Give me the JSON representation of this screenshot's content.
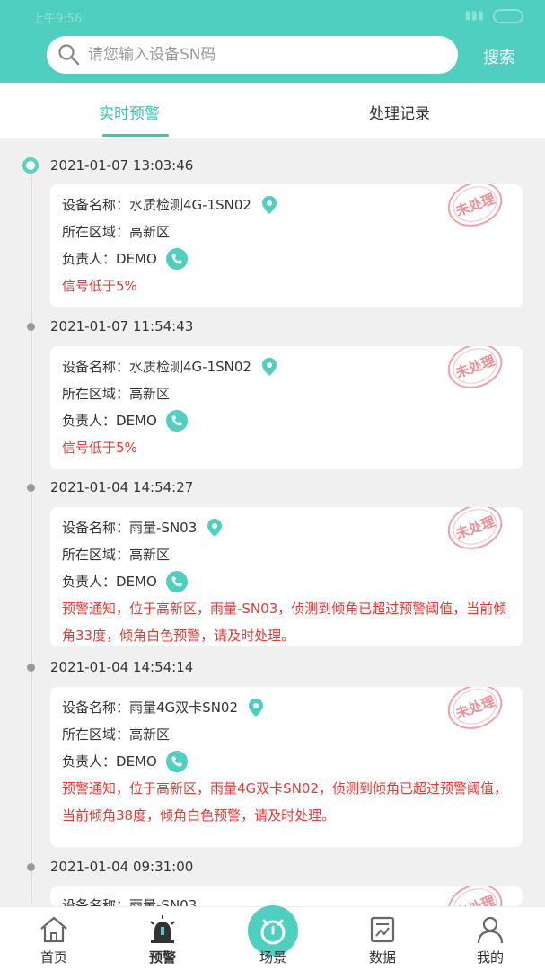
{
  "header": {
    "status_time": "上午9:56",
    "search_placeholder": "请您输入设备SN码",
    "search_button": "搜索",
    "accent_color": "#4fcfbf"
  },
  "tabs": [
    {
      "label": "实时预警",
      "active": true
    },
    {
      "label": "处理记录",
      "active": false
    }
  ],
  "labels": {
    "device_name": "设备名称：",
    "area": "所在区域：",
    "person": "负责人：",
    "stamp": "未处理"
  },
  "alerts": [
    {
      "time": "2021-01-07 13:03:46",
      "device": "水质检测4G-1SN02",
      "area": "高新区",
      "person": "DEMO",
      "message": "信号低于5%"
    },
    {
      "time": "2021-01-07 11:54:43",
      "device": "水质检测4G-1SN02",
      "area": "高新区",
      "person": "DEMO",
      "message": "信号低于5%"
    },
    {
      "time": "2021-01-04 14:54:27",
      "device": "雨量-SN03",
      "area": "高新区",
      "person": "DEMO",
      "message": "预警通知，位于高新区，雨量-SN03，侦测到倾角已超过预警阈值，当前倾角33度，倾角白色预警，请及时处理。"
    },
    {
      "time": "2021-01-04 14:54:14",
      "device": "雨量4G双卡SN02",
      "area": "高新区",
      "person": "DEMO",
      "message": "预警通知，位于高新区，雨量4G双卡SN02，侦测到倾角已超过预警阈值，当前倾角38度，倾角白色预警，请及时处理。"
    },
    {
      "time": "2021-01-04 09:31:00",
      "device": "雨量-SN03",
      "area": "",
      "person": "",
      "message": ""
    }
  ],
  "bottom_nav": [
    {
      "label": "首页",
      "icon": "home-icon"
    },
    {
      "label": "预警",
      "icon": "alarm-icon",
      "active": true
    },
    {
      "label": "场景",
      "icon": "scene-icon"
    },
    {
      "label": "数据",
      "icon": "data-icon"
    },
    {
      "label": "我的",
      "icon": "user-icon"
    }
  ]
}
